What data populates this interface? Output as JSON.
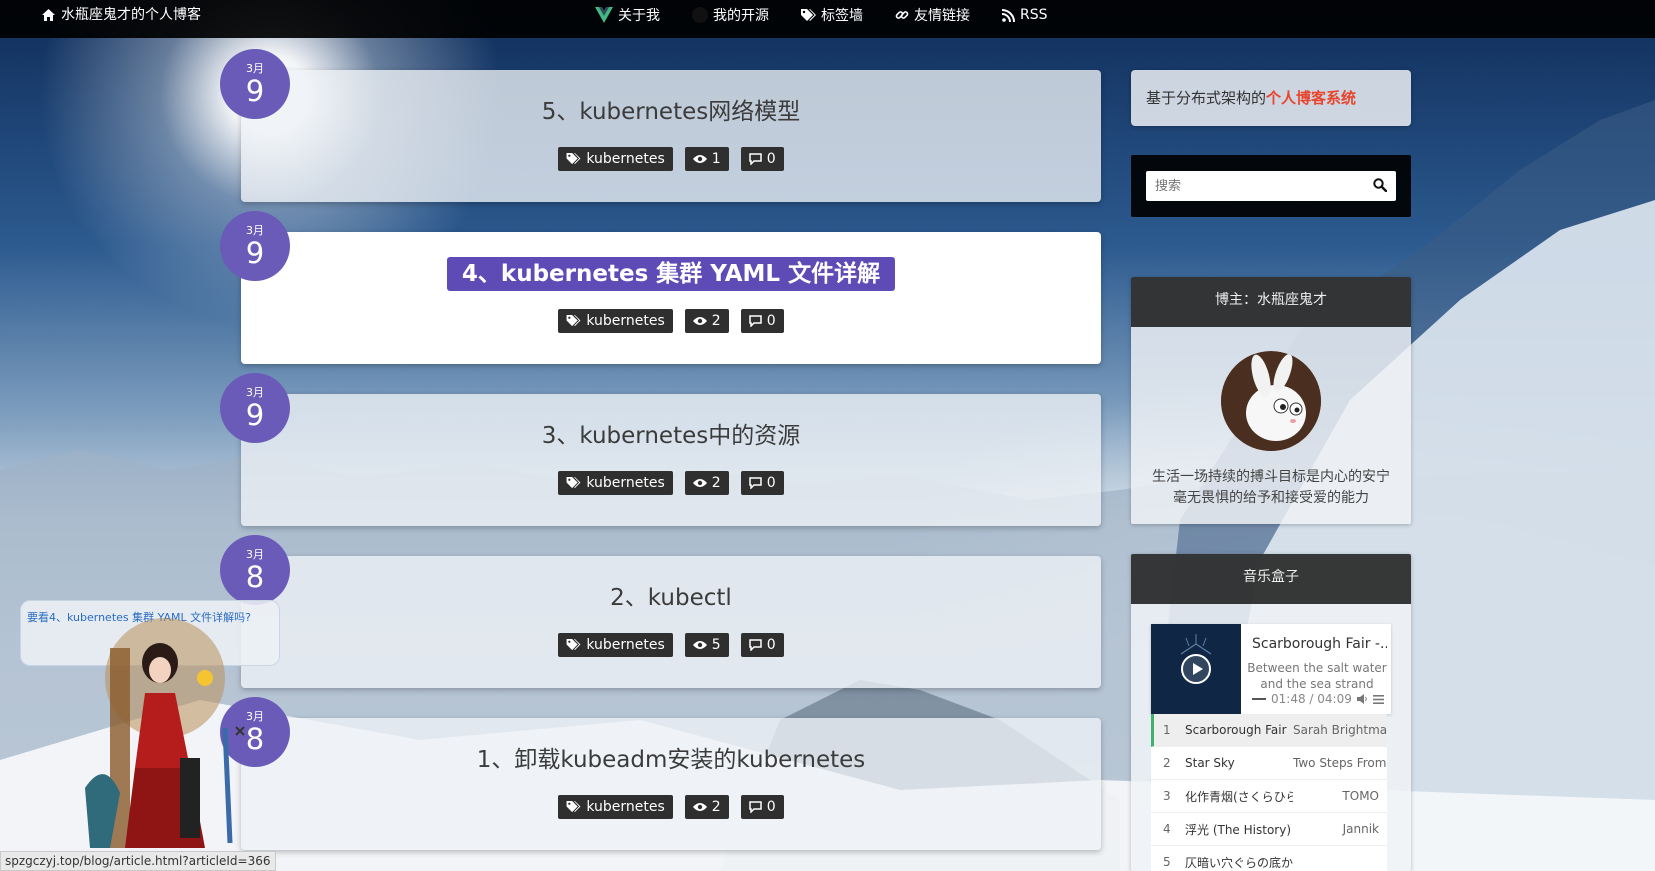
{
  "nav": {
    "brand_label": "水瓶座鬼才的个人博客",
    "links": [
      {
        "label": "关于我",
        "icon": "vue-icon"
      },
      {
        "label": "我的开源",
        "icon": "github-icon"
      },
      {
        "label": "标签墙",
        "icon": "tags-icon"
      },
      {
        "label": "友情链接",
        "icon": "link-icon"
      },
      {
        "label": "RSS",
        "icon": "rss-icon"
      }
    ]
  },
  "articles": [
    {
      "month": "3月",
      "day": "9",
      "title": "5、kubernetes网络模型",
      "tag": "kubernetes",
      "views": "1",
      "comments": "0"
    },
    {
      "month": "3月",
      "day": "9",
      "title": "4、kubernetes 集群 YAML 文件详解",
      "tag": "kubernetes",
      "views": "2",
      "comments": "0"
    },
    {
      "month": "3月",
      "day": "9",
      "title": "3、kubernetes中的资源",
      "tag": "kubernetes",
      "views": "2",
      "comments": "0"
    },
    {
      "month": "3月",
      "day": "8",
      "title": "2、kubectl",
      "tag": "kubernetes",
      "views": "5",
      "comments": "0"
    },
    {
      "month": "3月",
      "day": "8",
      "title": "1、卸载kubeadm安装的kubernetes",
      "tag": "kubernetes",
      "views": "2",
      "comments": "0"
    }
  ],
  "sidebar": {
    "promo_prefix": "基于分布式架构的",
    "promo_highlight": "个人博客系统",
    "search_placeholder": "搜索",
    "owner_title": "博主：水瓶座鬼才",
    "motto_line1": "生活一场持续的搏斗目标是内心的安宁",
    "motto_line2": "毫无畏惧的给予和接受爱的能力",
    "music_title": "音乐盒子"
  },
  "player": {
    "title": "Scarborough Fair -...",
    "lyric": "Between the salt water and the sea strand",
    "time": "01:48 / 04:09",
    "playlist": [
      {
        "num": "1",
        "title": "Scarborough Fair",
        "artist": "Sarah Brightman"
      },
      {
        "num": "2",
        "title": "Star Sky",
        "artist": "Two Steps From Hell"
      },
      {
        "num": "3",
        "title": "化作青烟(さくらひらり)",
        "artist": "TOMO"
      },
      {
        "num": "4",
        "title": "浮光 (The History)",
        "artist": "Jannik"
      },
      {
        "num": "5",
        "title": "仄暗い穴ぐらの底から",
        "artist": ""
      }
    ]
  },
  "widget": {
    "bubble_text": "要看4、kubernetes 集群 YAML 文件详解吗?"
  },
  "status_url": "spzgczyj.top/blog/article.html?articleId=366",
  "colors": {
    "date_circle": "#6b5bb8",
    "title_highlight": "#5f4bb6",
    "promo_highlight": "#e8452c"
  }
}
